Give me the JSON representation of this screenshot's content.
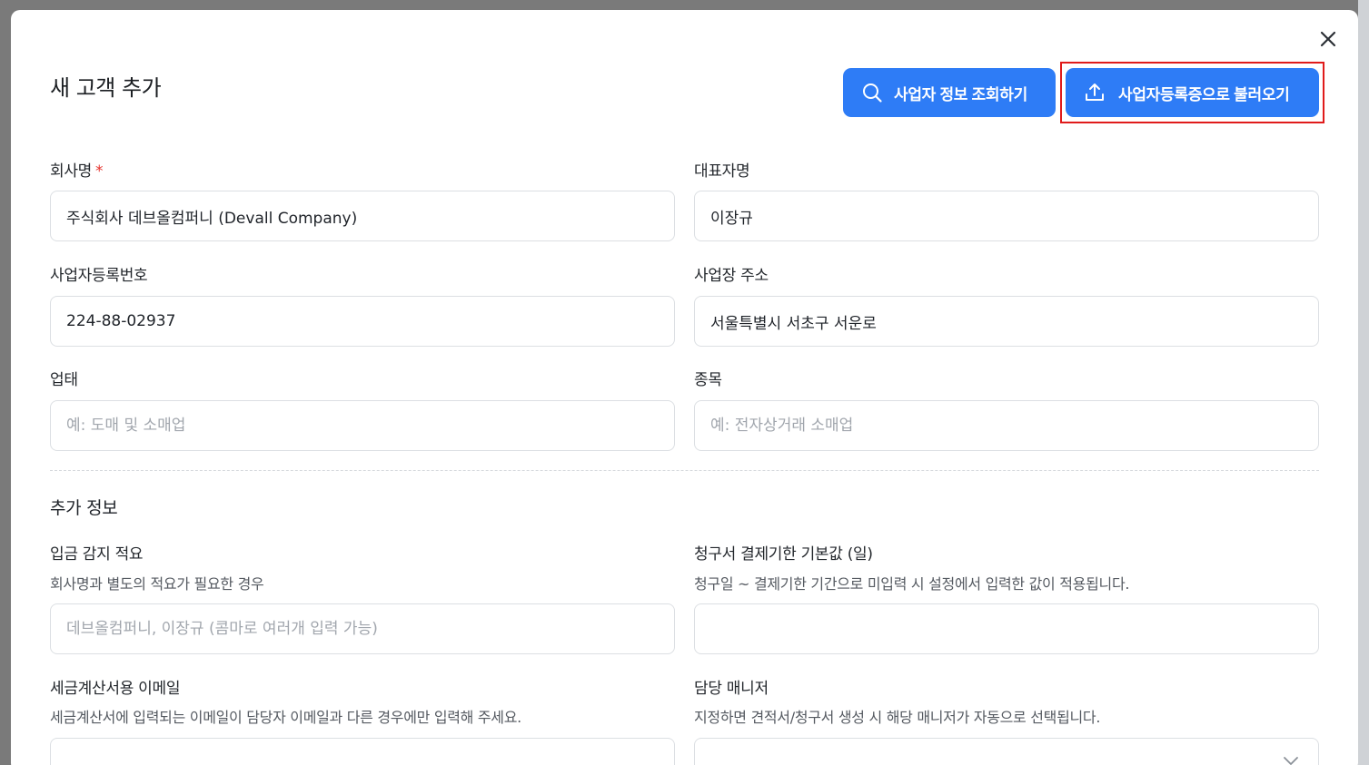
{
  "modal": {
    "title": "새 고객 추가",
    "close_icon": "close-icon",
    "lookup_button": {
      "label": "사업자 정보 조회하기",
      "icon": "search-icon"
    },
    "upload_button": {
      "label": "사업자등록증으로 불러오기",
      "icon": "upload-icon"
    }
  },
  "fields": {
    "company_name": {
      "label": "회사명",
      "required_mark": "*",
      "value": "주식회사 데브올컴퍼니 (Devall Company)"
    },
    "ceo_name": {
      "label": "대표자명",
      "value": "이장규"
    },
    "business_number": {
      "label": "사업자등록번호",
      "value": "224-88-02937"
    },
    "address": {
      "label": "사업장 주소",
      "value": "서울특별시 서초구 서운로"
    },
    "business_type": {
      "label": "업태",
      "placeholder": "예: 도매 및 소매업"
    },
    "business_item": {
      "label": "종목",
      "placeholder": "예: 전자상거래 소매업"
    }
  },
  "additional": {
    "section_title": "추가 정보",
    "deposit_memo": {
      "label": "입금 감지 적요",
      "description": "회사명과 별도의 적요가 필요한 경우",
      "placeholder": "데브올컴퍼니, 이장규 (콤마로 여러개 입력 가능)"
    },
    "payment_due": {
      "label": "청구서 결제기한 기본값 (일)",
      "description": "청구일 ~ 결제기한 기간으로 미입력 시 설정에서 입력한 값이 적용됩니다.",
      "value": ""
    },
    "tax_email": {
      "label": "세금계산서용 이메일",
      "description": "세금계산서에 입력되는 이메일이 담당자 이메일과 다른 경우에만 입력해 주세요.",
      "value": ""
    },
    "manager": {
      "label": "담당 매니저",
      "description": "지정하면 견적서/청구서 생성 시 해당 매니저가 자동으로 선택됩니다.",
      "icon": "chevron-down-icon"
    }
  },
  "colors": {
    "primary": "#2e7cf6",
    "highlight_border": "#e01b1b",
    "required": "#e5322d"
  }
}
